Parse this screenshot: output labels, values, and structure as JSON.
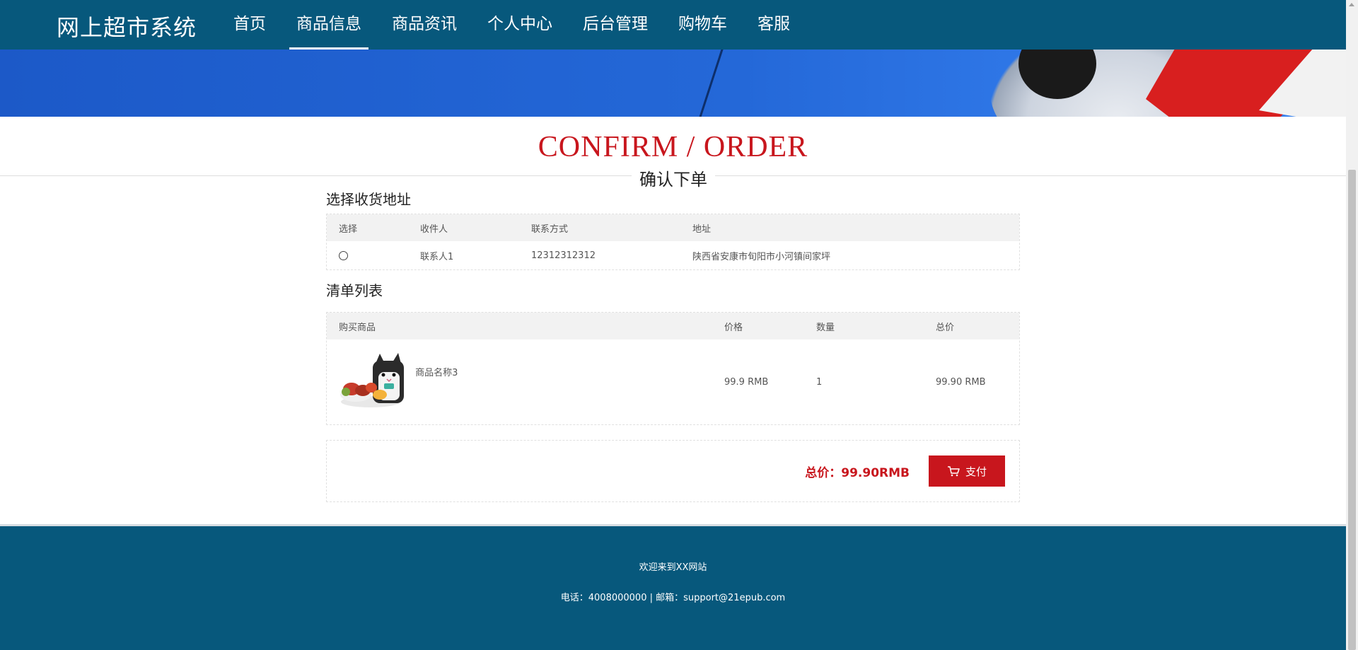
{
  "header": {
    "brand": "网上超市系统",
    "nav": [
      {
        "label": "首页",
        "active": false
      },
      {
        "label": "商品信息",
        "active": true
      },
      {
        "label": "商品资讯",
        "active": false
      },
      {
        "label": "个人中心",
        "active": false
      },
      {
        "label": "后台管理",
        "active": false
      },
      {
        "label": "购物车",
        "active": false
      },
      {
        "label": "客服",
        "active": false
      }
    ]
  },
  "page": {
    "title_en": "CONFIRM / ORDER",
    "title_cn": "确认下单"
  },
  "address": {
    "section_title": "选择收货地址",
    "columns": [
      "选择",
      "收件人",
      "联系方式",
      "地址"
    ],
    "rows": [
      {
        "recipient": "联系人1",
        "phone": "12312312312",
        "address": "陕西省安康市旬阳市小河镇间家坪",
        "selected": false
      }
    ]
  },
  "cart": {
    "section_title": "清单列表",
    "columns": [
      "购买商品",
      "价格",
      "数量",
      "总价"
    ],
    "items": [
      {
        "name": "商品名称3",
        "price": "99.9 RMB",
        "quantity": "1",
        "total": "99.90 RMB",
        "image_icon": "cat-snack-product-image"
      }
    ]
  },
  "summary": {
    "total_text": "总价：99.90RMB",
    "pay_label": "支付",
    "pay_icon": "cart-icon"
  },
  "footer": {
    "welcome": "欢迎来到XX网站",
    "contact": "电话：4008000000 | 邮箱：support@21epub.com"
  },
  "colors": {
    "header_bg": "#07587c",
    "accent_red": "#c8161d",
    "table_header_bg": "#f2f2f2"
  }
}
